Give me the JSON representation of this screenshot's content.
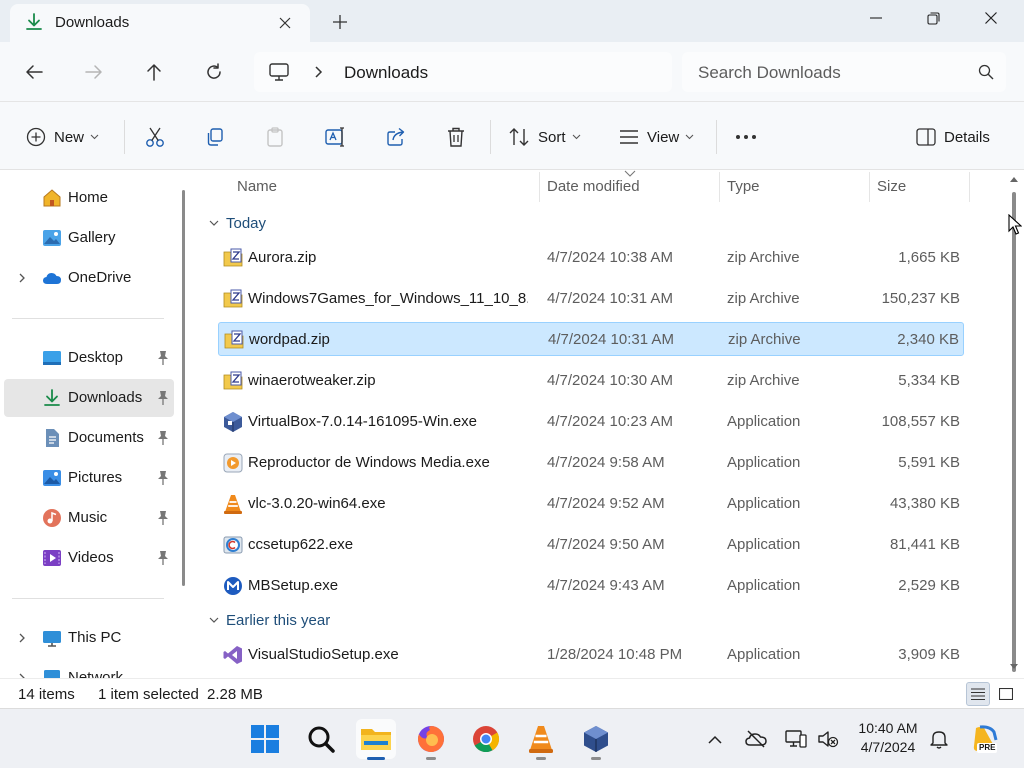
{
  "window": {
    "tab_title": "Downloads",
    "controls": {
      "minimize": "minimize",
      "restore": "restore",
      "close": "close"
    }
  },
  "address": {
    "breadcrumb": "Downloads",
    "search_placeholder": "Search Downloads"
  },
  "commands": {
    "new_label": "New",
    "sort_label": "Sort",
    "view_label": "View",
    "more_label": "···",
    "details_label": "Details"
  },
  "nav": {
    "items": [
      {
        "label": "Home",
        "icon": "home-icon"
      },
      {
        "label": "Gallery",
        "icon": "gallery-icon"
      },
      {
        "label": "OneDrive",
        "icon": "cloud-icon"
      },
      {
        "label": "Desktop",
        "icon": "desktop-icon"
      },
      {
        "label": "Downloads",
        "icon": "download-icon"
      },
      {
        "label": "Documents",
        "icon": "documents-icon"
      },
      {
        "label": "Pictures",
        "icon": "pictures-icon"
      },
      {
        "label": "Music",
        "icon": "music-icon"
      },
      {
        "label": "Videos",
        "icon": "videos-icon"
      },
      {
        "label": "This PC",
        "icon": "pc-icon"
      },
      {
        "label": "Network",
        "icon": "network-icon"
      }
    ]
  },
  "columns": {
    "name": "Name",
    "date": "Date modified",
    "type": "Type",
    "size": "Size"
  },
  "groups": {
    "today": "Today",
    "earlier": "Earlier this year"
  },
  "files": [
    {
      "name": "Aurora.zip",
      "date": "4/7/2024 10:38 AM",
      "type": "zip Archive",
      "size": "1,665 KB",
      "icon": "zip-icon"
    },
    {
      "name": "Windows7Games_for_Windows_11_10_8....",
      "date": "4/7/2024 10:31 AM",
      "type": "zip Archive",
      "size": "150,237 KB",
      "icon": "zip-icon"
    },
    {
      "name": "wordpad.zip",
      "date": "4/7/2024 10:31 AM",
      "type": "zip Archive",
      "size": "2,340 KB",
      "icon": "zip-icon"
    },
    {
      "name": "winaerotweaker.zip",
      "date": "4/7/2024 10:30 AM",
      "type": "zip Archive",
      "size": "5,334 KB",
      "icon": "zip-icon"
    },
    {
      "name": "VirtualBox-7.0.14-161095-Win.exe",
      "date": "4/7/2024 10:23 AM",
      "type": "Application",
      "size": "108,557 KB",
      "icon": "virtualbox-icon"
    },
    {
      "name": "Reproductor de Windows Media.exe",
      "date": "4/7/2024 9:58 AM",
      "type": "Application",
      "size": "5,591 KB",
      "icon": "media-player-icon"
    },
    {
      "name": "vlc-3.0.20-win64.exe",
      "date": "4/7/2024 9:52 AM",
      "type": "Application",
      "size": "43,380 KB",
      "icon": "vlc-icon"
    },
    {
      "name": "ccsetup622.exe",
      "date": "4/7/2024 9:50 AM",
      "type": "Application",
      "size": "81,441 KB",
      "icon": "ccleaner-icon"
    },
    {
      "name": "MBSetup.exe",
      "date": "4/7/2024 9:43 AM",
      "type": "Application",
      "size": "2,529 KB",
      "icon": "malwarebytes-icon"
    },
    {
      "name": "VisualStudioSetup.exe",
      "date": "1/28/2024 10:48 PM",
      "type": "Application",
      "size": "3,909 KB",
      "icon": "visual-studio-icon"
    }
  ],
  "status": {
    "items_count": "14 items",
    "selection": "1 item selected",
    "selection_size": "2.28 MB"
  },
  "taskbar": {
    "time": "10:40 AM",
    "date": "4/7/2024",
    "pre_badge": "PRE"
  },
  "colors": {
    "selection_bg": "#cce8ff",
    "selection_border": "#99d1ff",
    "accent": "#0067c0",
    "group_text": "#1f4e79"
  }
}
